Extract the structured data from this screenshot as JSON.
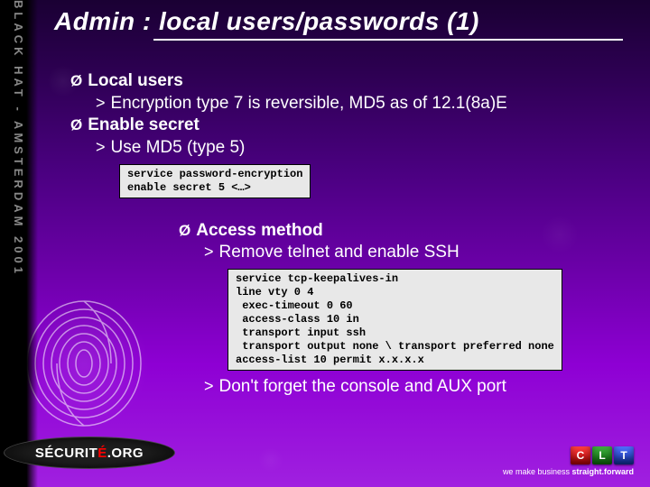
{
  "sidebar": {
    "vertical_text": "BLACK HAT - AMSTERDAM 2001"
  },
  "title": "Admin : local users/passwords (1)",
  "bullets": {
    "section1": {
      "heading": "Local users",
      "sub": "Encryption type 7 is reversible, MD5 as of 12.1(8a)E"
    },
    "section2": {
      "heading": "Enable secret",
      "sub": "Use MD5 (type 5)",
      "code": "service password-encryption\nenable secret 5 <…>"
    },
    "section3": {
      "heading": "Access method",
      "sub1": "Remove telnet and enable SSH",
      "code": "service tcp-keepalives-in\nline vty 0 4\n exec-timeout 0 60\n access-class 10 in\n transport input ssh\n transport output none \\ transport preferred none\naccess-list 10 permit x.x.x.x",
      "sub2": "Don't forget the console and AUX port"
    }
  },
  "footer": {
    "logo_pre": "SÉCURIT",
    "logo_red": "É",
    "logo_post": ".ORG",
    "clt": {
      "c1": "C",
      "c2": "L",
      "c3": "T"
    },
    "tagline_pre": "we make business ",
    "tagline_bold": "straight.forward"
  }
}
